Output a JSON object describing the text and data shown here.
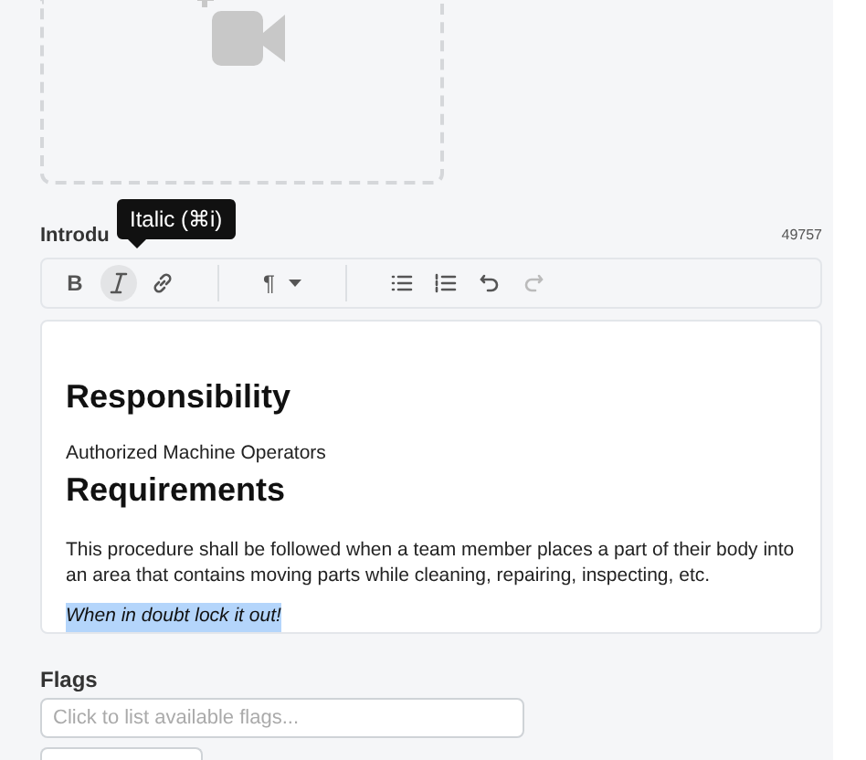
{
  "upload": {
    "kind": "video"
  },
  "introduction": {
    "label": "Introdu",
    "counter": "49757",
    "tooltip": "Italic (⌘i)",
    "toolbar": [
      {
        "kind": "bold",
        "label": "B",
        "active": false,
        "disabled": false
      },
      {
        "kind": "italic",
        "active": true,
        "disabled": false
      },
      {
        "kind": "link",
        "active": false,
        "disabled": false
      },
      {
        "kind": "divider"
      },
      {
        "kind": "paragraph",
        "label": "¶"
      },
      {
        "kind": "divider"
      },
      {
        "kind": "bullets",
        "active": false,
        "disabled": false
      },
      {
        "kind": "numbers",
        "active": false,
        "disabled": false
      },
      {
        "kind": "undo",
        "active": false,
        "disabled": false
      },
      {
        "kind": "redo",
        "active": false,
        "disabled": true
      }
    ],
    "blocks": [
      {
        "kind": "heading",
        "text": "Responsibility",
        "selected": false
      },
      {
        "kind": "text",
        "text": "Authorized Machine Operators",
        "selected": false
      },
      {
        "kind": "heading",
        "text": "Requirements",
        "selected": false
      },
      {
        "kind": "text",
        "text": "This procedure shall be followed when a team member places a part of their body into an area that contains moving parts while cleaning, repairing, inspecting, etc.",
        "selected": false
      },
      {
        "kind": "emphasis",
        "text": "When in doubt lock it out!",
        "selected": true
      }
    ]
  },
  "flags": {
    "label": "Flags",
    "placeholder": "Click to list available flags..."
  }
}
